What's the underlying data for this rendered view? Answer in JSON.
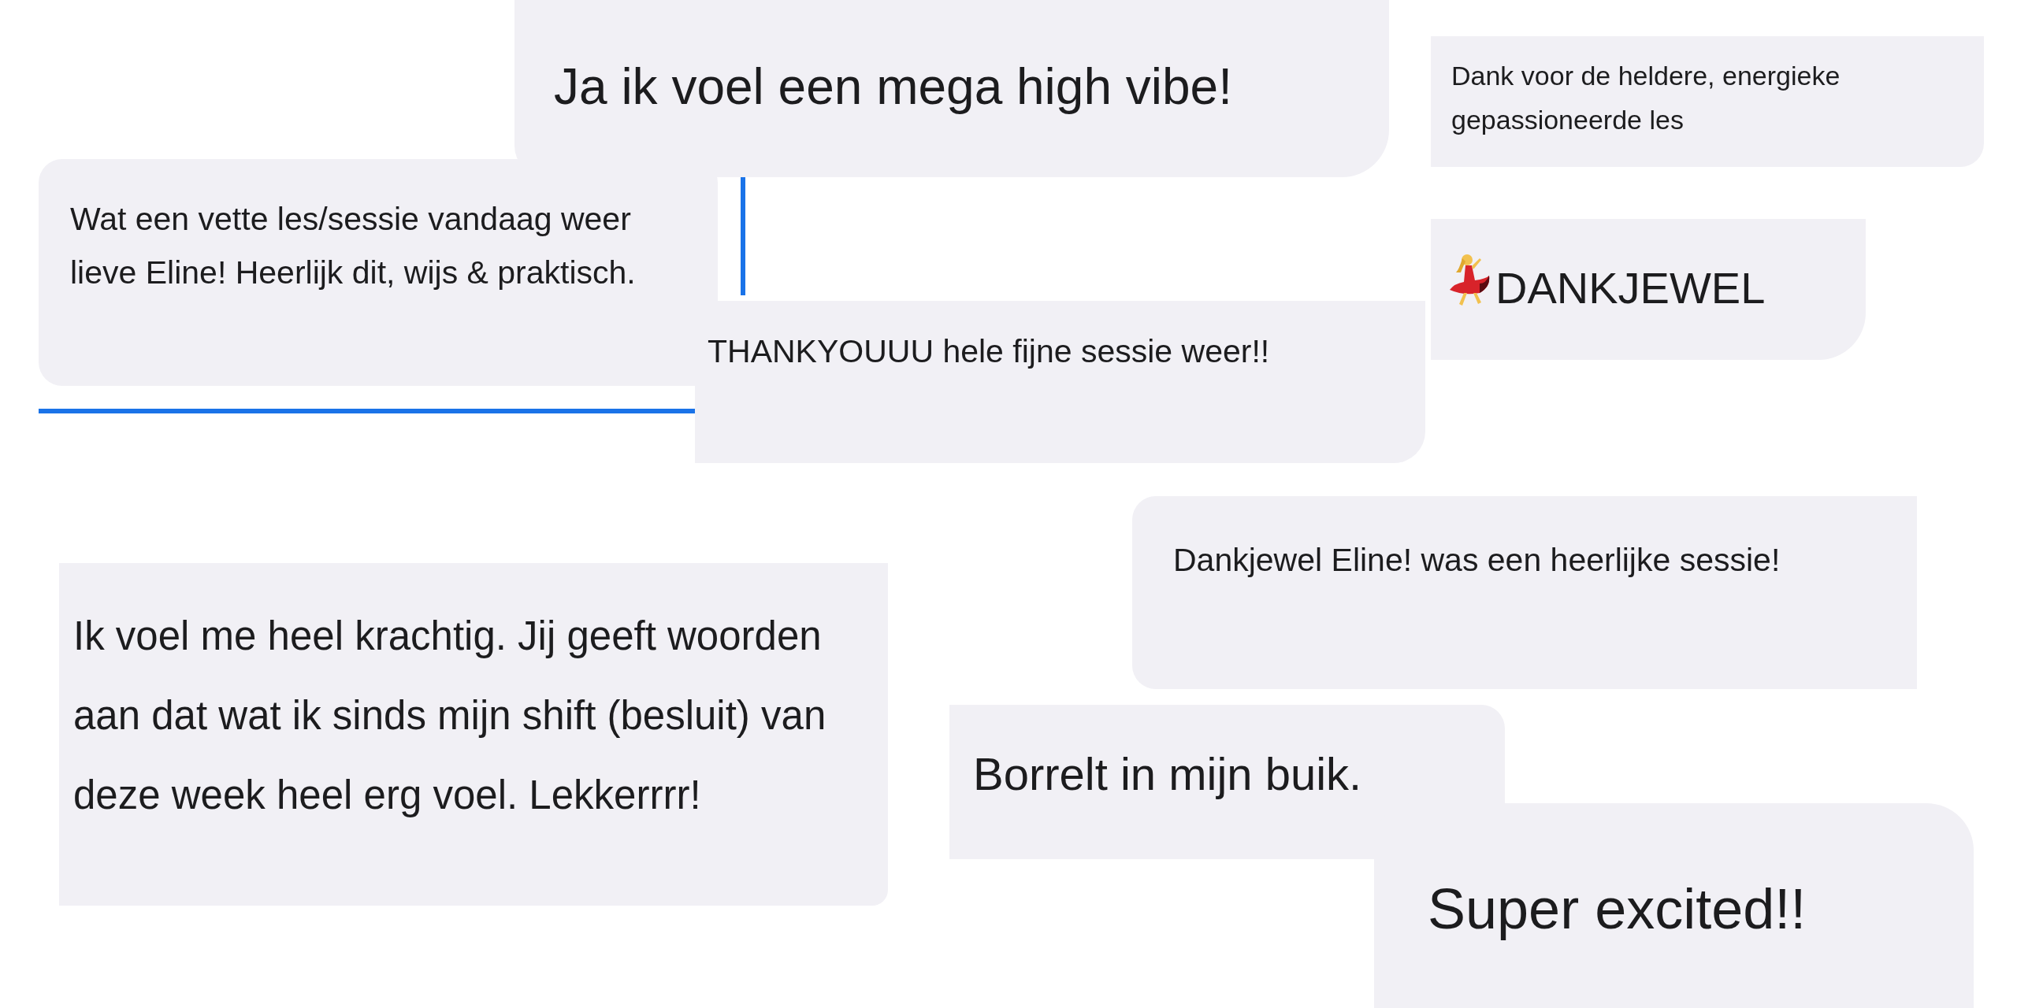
{
  "messages": [
    {
      "kind": "text",
      "text": "Ja ik voel een mega high vibe!"
    },
    {
      "kind": "text",
      "text": "Dank voor de heldere, energieke gepassioneerde les"
    },
    {
      "kind": "text",
      "text": "Wat een vette les/sessie vandaag weer lieve Eline! Heerlijk dit, wijs & praktisch."
    },
    {
      "kind": "text",
      "text": "THANKYOUUU hele fijne sessie weer!!"
    },
    {
      "kind": "dancer",
      "text": "DANKJEWEL"
    },
    {
      "kind": "text",
      "text": "Ik voel me heel krachtig. Jij geeft woorden aan dat wat ik sinds mijn shift (besluit) van deze week heel erg voel. Lekkerrrr!"
    },
    {
      "kind": "text",
      "text": "Dankjewel Eline! was een heerlijke sessie!"
    },
    {
      "kind": "text",
      "text": "Borrelt in mijn buik."
    },
    {
      "kind": "text",
      "text": "Super excited!!"
    }
  ]
}
